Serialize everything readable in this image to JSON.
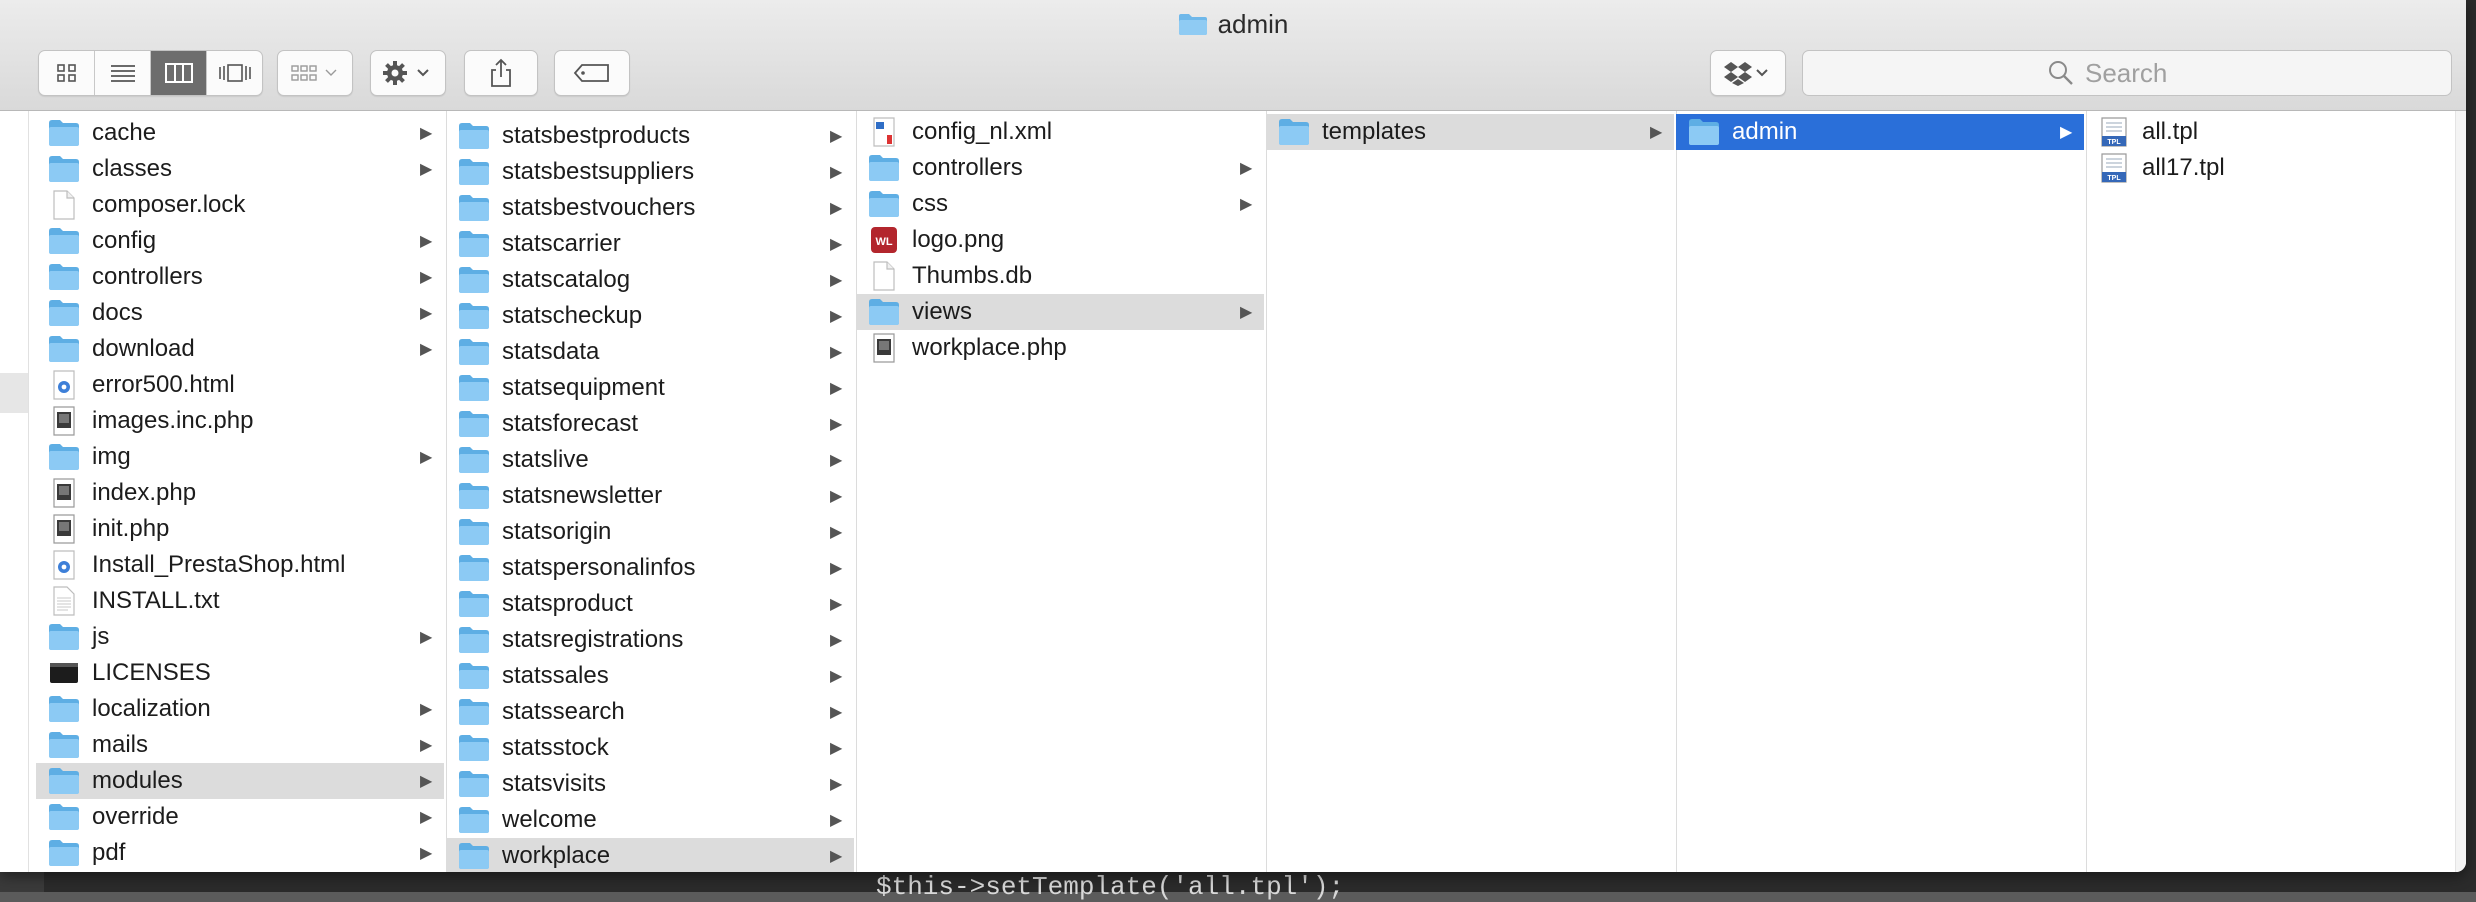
{
  "window": {
    "title": "admin"
  },
  "toolbar": {
    "view_icons": [
      "icon-view-icon",
      "list-view-icon",
      "column-view-icon",
      "cover-flow-icon"
    ],
    "search_placeholder": "Search"
  },
  "background_code": "$this->setTemplate('all.tpl');",
  "columns": [
    {
      "items": [
        {
          "name": "cache",
          "type": "folder",
          "arrow": true
        },
        {
          "name": "classes",
          "type": "folder",
          "arrow": true
        },
        {
          "name": "composer.lock",
          "type": "doc",
          "arrow": false
        },
        {
          "name": "config",
          "type": "folder",
          "arrow": true
        },
        {
          "name": "controllers",
          "type": "folder",
          "arrow": true
        },
        {
          "name": "docs",
          "type": "folder",
          "arrow": true
        },
        {
          "name": "download",
          "type": "folder",
          "arrow": true
        },
        {
          "name": "error500.html",
          "type": "html",
          "arrow": false
        },
        {
          "name": "images.inc.php",
          "type": "php",
          "arrow": false
        },
        {
          "name": "img",
          "type": "folder",
          "arrow": true
        },
        {
          "name": "index.php",
          "type": "php",
          "arrow": false
        },
        {
          "name": "init.php",
          "type": "php",
          "arrow": false
        },
        {
          "name": "Install_PrestaShop.html",
          "type": "html",
          "arrow": false
        },
        {
          "name": "INSTALL.txt",
          "type": "txt",
          "arrow": false
        },
        {
          "name": "js",
          "type": "folder",
          "arrow": true
        },
        {
          "name": "LICENSES",
          "type": "exec",
          "arrow": false
        },
        {
          "name": "localization",
          "type": "folder",
          "arrow": true
        },
        {
          "name": "mails",
          "type": "folder",
          "arrow": true
        },
        {
          "name": "modules",
          "type": "folder",
          "arrow": true,
          "selected": "gray"
        },
        {
          "name": "override",
          "type": "folder",
          "arrow": true
        },
        {
          "name": "pdf",
          "type": "folder",
          "arrow": true
        }
      ]
    },
    {
      "items": [
        {
          "name": "statsbestproducts",
          "type": "folder",
          "arrow": true
        },
        {
          "name": "statsbestsuppliers",
          "type": "folder",
          "arrow": true
        },
        {
          "name": "statsbestvouchers",
          "type": "folder",
          "arrow": true
        },
        {
          "name": "statscarrier",
          "type": "folder",
          "arrow": true
        },
        {
          "name": "statscatalog",
          "type": "folder",
          "arrow": true
        },
        {
          "name": "statscheckup",
          "type": "folder",
          "arrow": true
        },
        {
          "name": "statsdata",
          "type": "folder",
          "arrow": true
        },
        {
          "name": "statsequipment",
          "type": "folder",
          "arrow": true
        },
        {
          "name": "statsforecast",
          "type": "folder",
          "arrow": true
        },
        {
          "name": "statslive",
          "type": "folder",
          "arrow": true
        },
        {
          "name": "statsnewsletter",
          "type": "folder",
          "arrow": true
        },
        {
          "name": "statsorigin",
          "type": "folder",
          "arrow": true
        },
        {
          "name": "statspersonalinfos",
          "type": "folder",
          "arrow": true
        },
        {
          "name": "statsproduct",
          "type": "folder",
          "arrow": true
        },
        {
          "name": "statsregistrations",
          "type": "folder",
          "arrow": true
        },
        {
          "name": "statssales",
          "type": "folder",
          "arrow": true
        },
        {
          "name": "statssearch",
          "type": "folder",
          "arrow": true
        },
        {
          "name": "statsstock",
          "type": "folder",
          "arrow": true
        },
        {
          "name": "statsvisits",
          "type": "folder",
          "arrow": true
        },
        {
          "name": "welcome",
          "type": "folder",
          "arrow": true
        },
        {
          "name": "workplace",
          "type": "folder",
          "arrow": true,
          "selected": "gray"
        }
      ]
    },
    {
      "items": [
        {
          "name": "config_nl.xml",
          "type": "xml",
          "arrow": false
        },
        {
          "name": "controllers",
          "type": "folder",
          "arrow": true
        },
        {
          "name": "css",
          "type": "folder",
          "arrow": true
        },
        {
          "name": "logo.png",
          "type": "png",
          "arrow": false
        },
        {
          "name": "Thumbs.db",
          "type": "doc",
          "arrow": false
        },
        {
          "name": "views",
          "type": "folder",
          "arrow": true,
          "selected": "gray"
        },
        {
          "name": "workplace.php",
          "type": "php",
          "arrow": false
        }
      ]
    },
    {
      "items": [
        {
          "name": "templates",
          "type": "folder",
          "arrow": true,
          "selected": "gray"
        }
      ]
    },
    {
      "items": [
        {
          "name": "admin",
          "type": "folder",
          "arrow": true,
          "selected": "blue"
        }
      ]
    },
    {
      "items": [
        {
          "name": "all.tpl",
          "type": "tpl",
          "arrow": false
        },
        {
          "name": "all17.tpl",
          "type": "tpl",
          "arrow": false
        }
      ]
    }
  ]
}
